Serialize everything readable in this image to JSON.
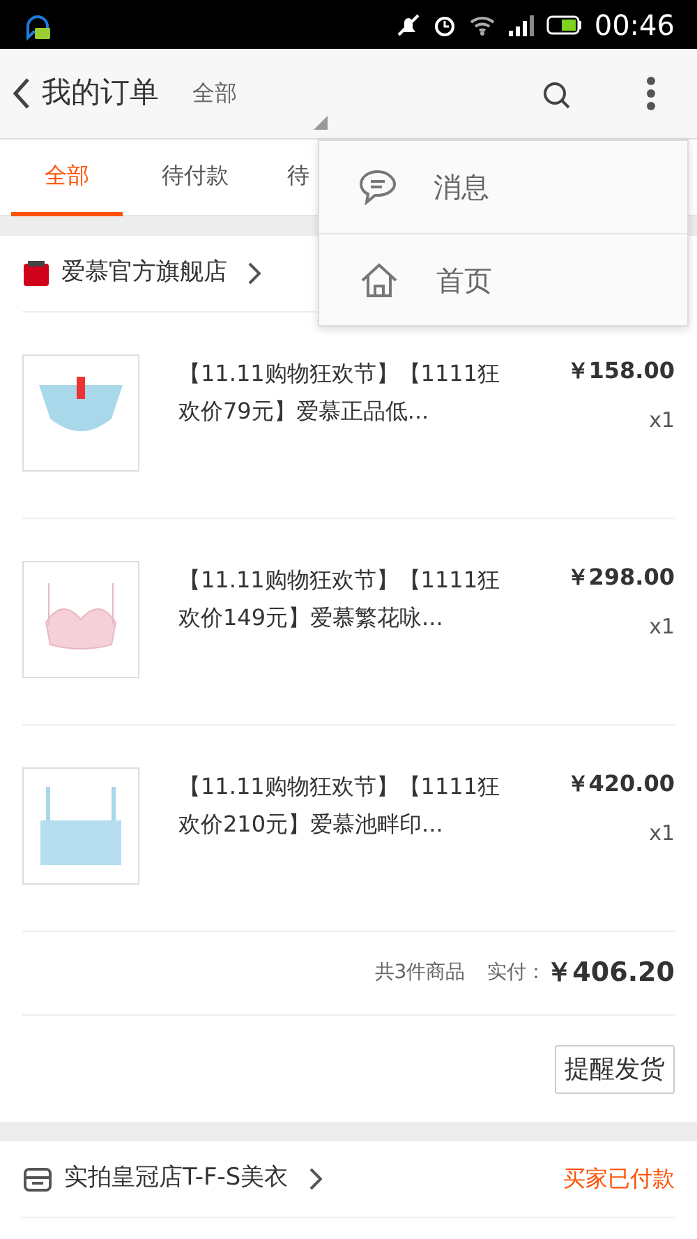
{
  "status_bar": {
    "time": "00:46"
  },
  "header": {
    "title": "我的订单",
    "filter": "全部"
  },
  "tabs": [
    {
      "label": "全部",
      "selected": true
    },
    {
      "label": "待付款",
      "selected": false
    },
    {
      "label": "待",
      "selected": false
    }
  ],
  "menu": {
    "items": [
      {
        "kind": "message",
        "label": "消息"
      },
      {
        "kind": "home",
        "label": "首页"
      }
    ]
  },
  "orders": [
    {
      "store": {
        "kind": "tmall",
        "name": "爱慕官方旗舰店"
      },
      "items": [
        {
          "kind": "panties",
          "title": "【11.11购物狂欢节】【1111狂欢价79元】爱慕正品低...",
          "price": "￥158.00",
          "qty": "x1"
        },
        {
          "kind": "bra",
          "title": "【11.11购物狂欢节】【1111狂欢价149元】爱慕繁花咏...",
          "price": "￥298.00",
          "qty": "x1"
        },
        {
          "kind": "bandeau",
          "title": "【11.11购物狂欢节】【1111狂欢价210元】爱慕池畔印...",
          "price": "￥420.00",
          "qty": "x1"
        }
      ],
      "count": "共3件商品",
      "paid_label": "实付：",
      "total": "￥406.20",
      "action": "提醒发货"
    },
    {
      "store": {
        "kind": "shop",
        "name": "实拍皇冠店T-F-S美衣"
      },
      "status": "买家已付款"
    }
  ]
}
